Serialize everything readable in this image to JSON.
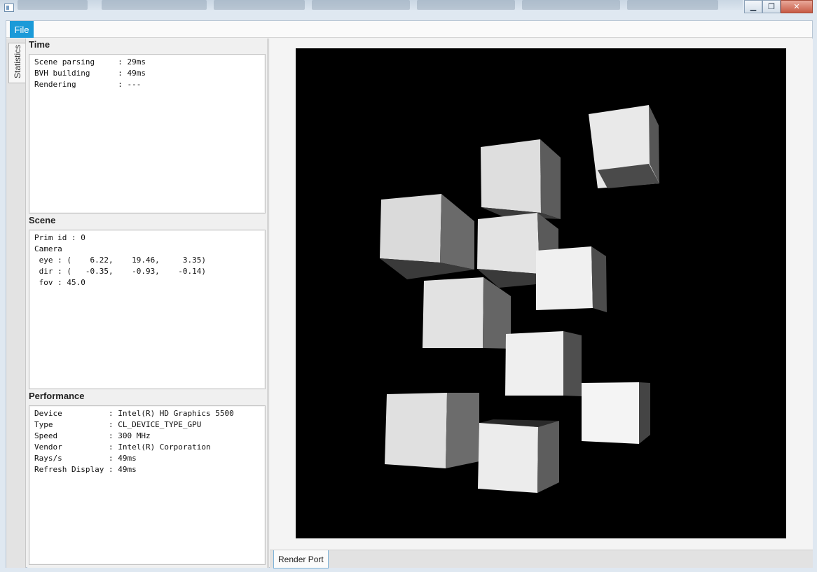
{
  "menu": {
    "file_label": "File"
  },
  "side_tabs": {
    "statistics_label": "Statistics"
  },
  "sections": {
    "time": {
      "title": "Time",
      "lines": [
        "Scene parsing     : 29ms",
        "BVH building      : 49ms",
        "Rendering         : ---"
      ]
    },
    "scene": {
      "title": "Scene",
      "lines": [
        "Prim id : 0",
        "Camera",
        " eye : (    6.22,    19.46,     3.35)",
        " dir : (   -0.35,    -0.93,    -0.14)",
        " fov : 45.0"
      ]
    },
    "performance": {
      "title": "Performance",
      "lines": [
        "Device          : Intel(R) HD Graphics 5500",
        "Type            : CL_DEVICE_TYPE_GPU",
        "Speed           : 300 MHz",
        "Vendor          : Intel(R) Corporation",
        "Rays/s          : 49ms",
        "Refresh Display : 49ms"
      ]
    }
  },
  "bottom_tabs": {
    "render_port_label": "Render Port"
  },
  "colors": {
    "accent": "#1b9ad8",
    "canvas_bg": "#000000",
    "cube_front": "#e6e6e6",
    "cube_side": "#5e5e5e",
    "cube_bottom": "#3c3c3c"
  },
  "render": {
    "cube_count": 11
  }
}
